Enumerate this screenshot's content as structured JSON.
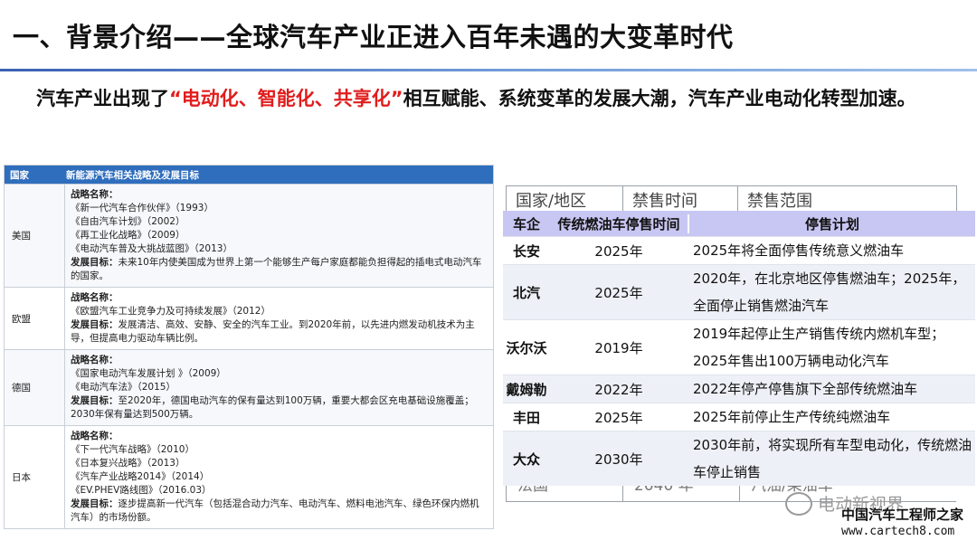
{
  "title": "一、背景介绍——全球汽车产业正进入百年未遇的大变革时代",
  "subtitle": {
    "part1": "汽车产业出现了",
    "highlight": "“电动化、智能化、共享化”",
    "part2": "相互赋能、系统变革的发展大潮，汽车产业电动化转型加速。"
  },
  "left_table": {
    "headers": [
      "国家",
      "新能源汽车相关战略及发展目标"
    ],
    "rows": [
      {
        "country": "美国",
        "lines": [
          {
            "bold": "战略名称：",
            "text": ""
          },
          {
            "bold": "",
            "text": "《新一代汽车合作伙伴》（1993）"
          },
          {
            "bold": "",
            "text": "《自由汽车计划》（2002）"
          },
          {
            "bold": "",
            "text": "《再工业化战略》（2009）"
          },
          {
            "bold": "",
            "text": "《电动汽车普及大挑战蓝图》（2013）"
          },
          {
            "bold": "发展目标：",
            "text": "未来10年内使美国成为世界上第一个能够生产每户家庭都能负担得起的插电式电动汽车的国家。"
          }
        ]
      },
      {
        "country": "欧盟",
        "lines": [
          {
            "bold": "战略名称：",
            "text": ""
          },
          {
            "bold": "",
            "text": "《欧盟汽车工业竞争力及可持续发展》（2012）"
          },
          {
            "bold": "发展目标：",
            "text": "发展清洁、高效、安静、安全的汽车工业。到2020年前，以先进内燃发动机技术为主导，但提高电力驱动车辆比例。"
          }
        ]
      },
      {
        "country": "德国",
        "lines": [
          {
            "bold": "战略名称：",
            "text": ""
          },
          {
            "bold": "",
            "text": "《国家电动汽车发展计划 》（2009）"
          },
          {
            "bold": "",
            "text": "《电动汽车法》（2015）"
          },
          {
            "bold": "发展目标：",
            "text": "至2020年，德国电动汽车的保有量达到100万辆，重要大都会区充电基础设施覆盖；2030年保有量达到500万辆。"
          }
        ]
      },
      {
        "country": "日本",
        "lines": [
          {
            "bold": "战略名称：",
            "text": ""
          },
          {
            "bold": "",
            "text": "《下一代汽车战略》（2010）"
          },
          {
            "bold": "",
            "text": "《日本复兴战略》（2013）"
          },
          {
            "bold": "",
            "text": "《汽车产业战略2014》（2014）"
          },
          {
            "bold": "",
            "text": "《EV.PHEV路线图》（2016.03）"
          },
          {
            "bold": "发展目标：",
            "text": "逐步提高新一代汽车（包括混合动力汽车、电动汽车、燃料电池汽车、绿色环保内燃机汽车）的市场份额。"
          }
        ]
      }
    ]
  },
  "right_bg_table": {
    "headers": [
      "国家/地区",
      "禁售时间",
      "禁售范围"
    ],
    "bottom": [
      "法国",
      "2040 年",
      "汽油/柴油车"
    ]
  },
  "right_table": {
    "headers": [
      "车企",
      "传统燃油车停售时间",
      "停售计划"
    ],
    "rows": [
      {
        "company": "长安",
        "year": "2025年",
        "plan": "2025年将全面停售传统意义燃油车"
      },
      {
        "company": "北汽",
        "year": "2025年",
        "plan": "2020年，在北京地区停售燃油车；2025年，全面停止销售燃油汽车"
      },
      {
        "company": "沃尔沃",
        "year": "2019年",
        "plan": "2019年起停止生产销售传统内燃机车型；2025年售出100万辆电动化汽车"
      },
      {
        "company": "戴姆勒",
        "year": "2022年",
        "plan": "2022年停产停售旗下全部传统燃油车"
      },
      {
        "company": "丰田",
        "year": "2025年",
        "plan": "2025年前停止生产传统纯燃油车"
      },
      {
        "company": "大众",
        "year": "2030年",
        "plan": "2030年前，将实现所有车型电动化，传统燃油车停止销售"
      }
    ]
  },
  "watermark": {
    "wechat": "电动新视界",
    "site_name": "中国汽车工程师之家",
    "url": "www.cartech8.com"
  },
  "colors": {
    "highlight": "#e11d1d",
    "left_header_bg": "#2f6ebd",
    "right_header_bg": "#c8c6f2"
  }
}
